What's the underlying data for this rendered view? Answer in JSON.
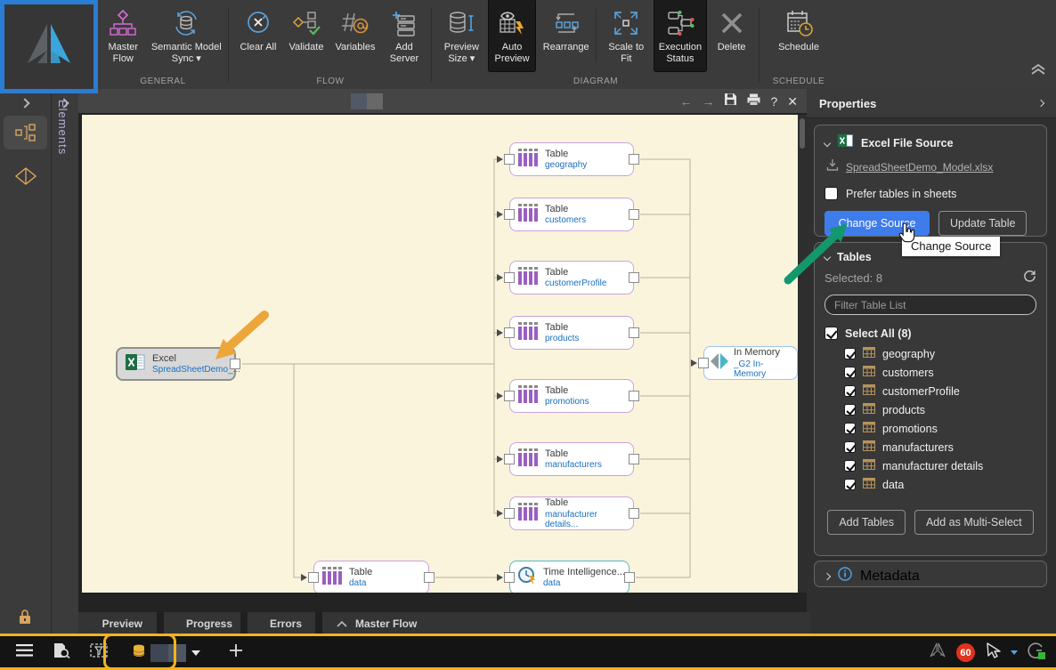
{
  "ribbon": {
    "general": {
      "label": "GENERAL",
      "master_flow": "Master Flow",
      "semantic_sync": "Semantic Model Sync ▾"
    },
    "flow": {
      "label": "FLOW",
      "clear_all": "Clear All",
      "validate": "Validate",
      "variables": "Variables",
      "add_server": "Add Server"
    },
    "diagram": {
      "label": "DIAGRAM",
      "preview_size": "Preview Size ▾",
      "auto_preview": "Auto Preview",
      "rearrange": "Rearrange",
      "scale_to_fit": "Scale to Fit",
      "execution_status": "Execution Status",
      "delete": "Delete"
    },
    "schedule": {
      "label": "SCHEDULE",
      "schedule": "Schedule"
    }
  },
  "sidebar": {
    "elements": "Elements"
  },
  "canvas_header": {
    "help": "?",
    "close": "✕",
    "back": "←",
    "forward": "→"
  },
  "canvas": {
    "excel": {
      "title": "Excel",
      "subtitle": "SpreadSheetDemo_..."
    },
    "tables": [
      {
        "title": "Table",
        "subtitle": "geography"
      },
      {
        "title": "Table",
        "subtitle": "customers"
      },
      {
        "title": "Table",
        "subtitle": "customerProfile"
      },
      {
        "title": "Table",
        "subtitle": "products"
      },
      {
        "title": "Table",
        "subtitle": "promotions"
      },
      {
        "title": "Table",
        "subtitle": "manufacturers"
      },
      {
        "title": "Table",
        "subtitle": "manufacturer details..."
      }
    ],
    "data_table": {
      "title": "Table",
      "subtitle": "data"
    },
    "time_intelligence": {
      "title": "Time Intelligence...",
      "subtitle": "data"
    },
    "in_memory": {
      "title": "In Memory",
      "subtitle": "_G2 In-Memory"
    }
  },
  "properties": {
    "title": "Properties",
    "source": {
      "title": "Excel File Source",
      "file": "SpreadSheetDemo_Model.xlsx",
      "prefer_label": "Prefer tables in sheets",
      "change_source": "Change Source",
      "update_table": "Update Table"
    },
    "tooltip": "Change Source",
    "tables": {
      "title": "Tables",
      "selected": "Selected: 8",
      "filter_placeholder": "Filter Table List",
      "select_all": "Select All (8)",
      "items": [
        "geography",
        "customers",
        "customerProfile",
        "products",
        "promotions",
        "manufacturers",
        "manufacturer details",
        "data"
      ],
      "add_tables": "Add Tables",
      "add_multi_select": "Add as Multi-Select"
    },
    "metadata": "Metadata"
  },
  "bottom_tabs": [
    "Preview",
    "Progress",
    "Errors",
    "Master Flow"
  ],
  "status_bar": {
    "badge": "60"
  },
  "colors": {
    "accent_blue": "#3f7ceb",
    "annotation_yellow": "#f2b31d",
    "annotation_green": "#12986c",
    "annotation_orange": "#eda63a",
    "annotation_box_blue": "#2b7cd3",
    "canvas_bg": "#faf4dc",
    "node_purple_border": "#c9a3dd",
    "node_teal_border": "#53b7c6",
    "node_blue_border": "#9cc4ea",
    "badge_red": "#e0321e",
    "node_subtitle_blue": "#1a6fc0"
  }
}
